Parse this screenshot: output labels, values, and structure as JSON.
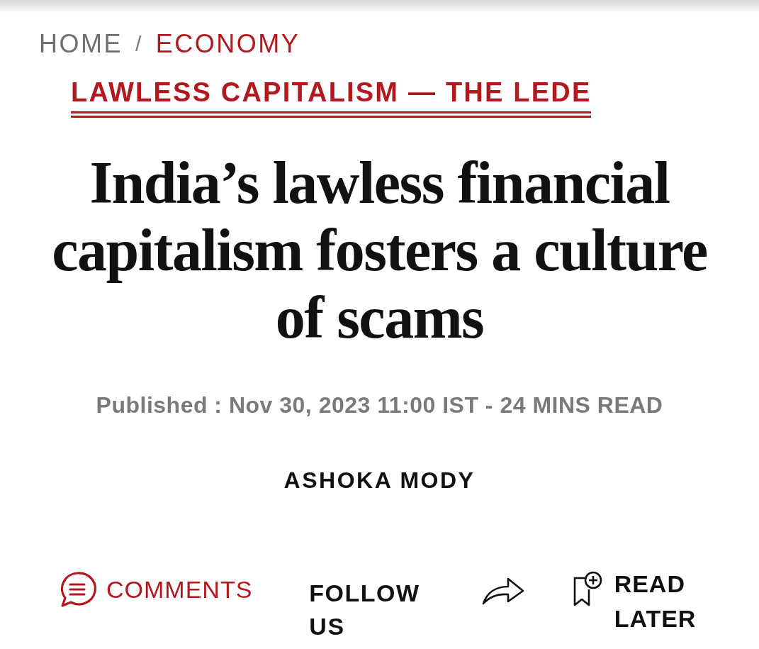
{
  "breadcrumb": {
    "separator": "/",
    "items": [
      {
        "label": "HOME",
        "current": false
      },
      {
        "label": "ECONOMY",
        "current": true
      }
    ]
  },
  "kicker": "LAWLESS CAPITALISM — THE LEDE",
  "headline": "India’s lawless financial capitalism fosters a culture of scams",
  "meta": "Published : Nov 30, 2023 11:00 IST - 24 MINS READ",
  "author": "ASHOKA MODY",
  "actions": [
    {
      "kind": "comments",
      "label": "COMMENTS"
    },
    {
      "kind": "follow",
      "label": "FOLLOW US"
    },
    {
      "kind": "share"
    },
    {
      "kind": "read_later",
      "label": "READ LATER"
    }
  ]
}
